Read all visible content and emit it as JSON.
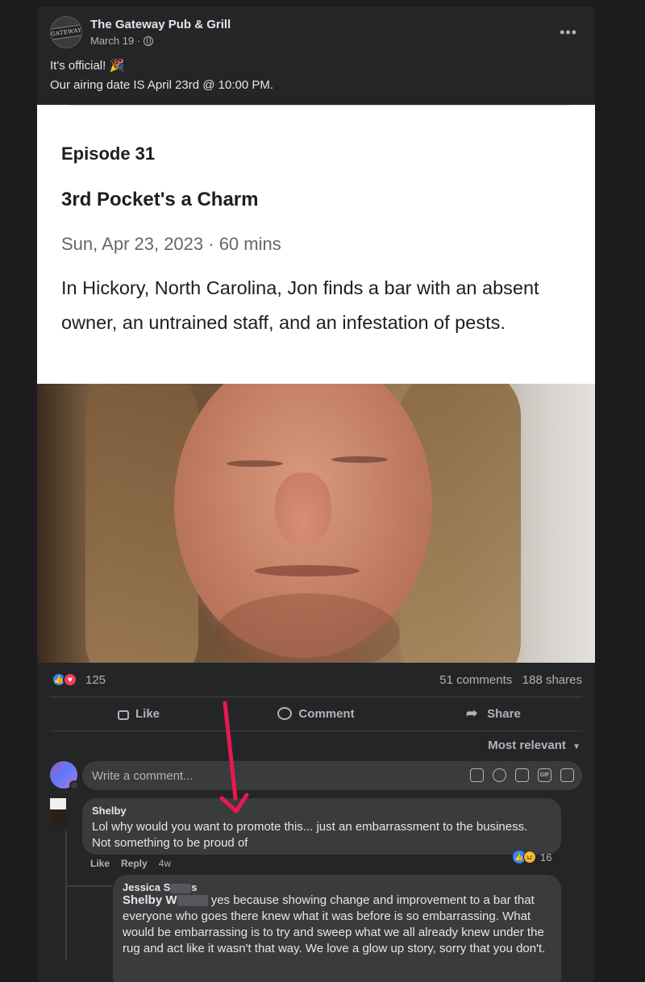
{
  "post": {
    "page_name": "The Gateway Pub & Grill",
    "date": "March 19 ·",
    "logo_text": "GATEWAY",
    "text_line1": "It's official! 🎉",
    "text_line2": "Our airing date IS April 23rd @ 10:00 PM."
  },
  "episode_card": {
    "episode": "Episode 31",
    "title": "3rd Pocket's a Charm",
    "meta": "Sun, Apr 23, 2023  ·  60 mins",
    "description": "In Hickory, North Carolina, Jon finds a bar with an absent owner, an untrained staff, and an infestation of pests."
  },
  "stats": {
    "reaction_count": "125",
    "comments_shares": "51 comments   188 shares"
  },
  "actions": {
    "like": "Like",
    "comment": "Comment",
    "share": "Share"
  },
  "comments_filter": "Most relevant",
  "composer": {
    "placeholder": "Write a comment..."
  },
  "comments": [
    {
      "author": "Shelby",
      "text_line1": "Lol why would you want to promote this... just an embarrassment to the business.",
      "text_line2": "Not something to be proud of",
      "reaction_count": "16",
      "like_label": "Like",
      "reply_label": "Reply",
      "time": "4w"
    }
  ],
  "reply": {
    "author_first": "Jessica S",
    "author_last": "s",
    "mention": "Shelby W",
    "mention_suffix": "yes because showing change and improvement to a bar that everyone who goes there knew what it was before is so embarrassing. What would be embarrassing is to try and sweep what we all already knew under the rug and act like it wasn't that way. We love a glow up story, sorry that you don't."
  },
  "colors": {
    "background": "#1c1c1e",
    "card": "#242526",
    "bubble": "#3a3b3c",
    "annotation_arrow": "#e8194f",
    "like_blue": "#2d88ff",
    "love_red": "#f33e58"
  }
}
